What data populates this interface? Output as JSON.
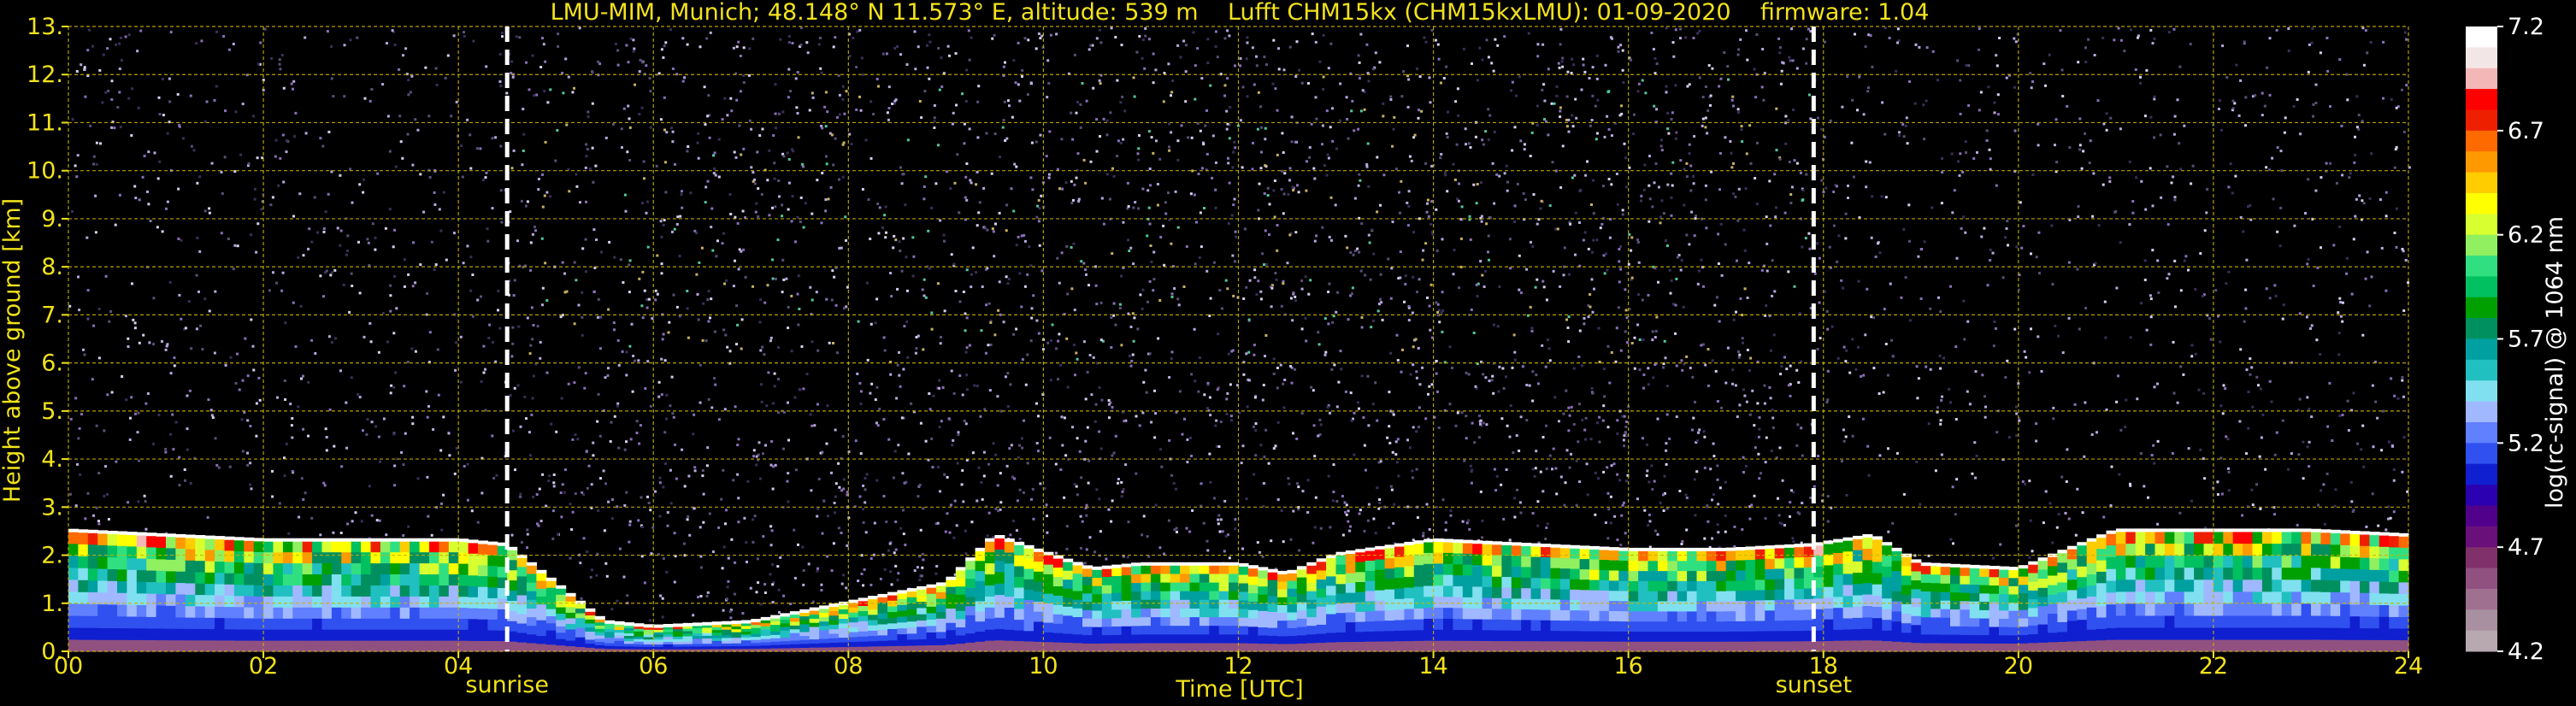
{
  "colors": {
    "background": "#000000",
    "text": "#f2e21a",
    "grid": "#c8b400",
    "event_line": "#ffffff",
    "noise": [
      "#8a6fb8",
      "#b8a8e0",
      "#5a4f7a",
      "#d8d0f0",
      "#3a2f5a"
    ]
  },
  "chart_data": {
    "type": "heatmap",
    "title": "LMU-MIM, Munich; 48.148° N 11.573° E, altitude: 539 m    Lufft CHM15kx (CHM15kxLMU): 01-09-2020    firmware: 1.04",
    "xlabel": "Time [UTC]",
    "ylabel": "Height above ground [km]",
    "xlim": [
      0,
      24
    ],
    "ylim": [
      0,
      13
    ],
    "x_ticks": [
      "00",
      "02",
      "04",
      "06",
      "08",
      "10",
      "12",
      "14",
      "16",
      "18",
      "20",
      "22",
      "24"
    ],
    "x_tick_values": [
      0,
      2,
      4,
      6,
      8,
      10,
      12,
      14,
      16,
      18,
      20,
      22,
      24
    ],
    "y_ticks": [
      "0.",
      "1.",
      "2.",
      "3.",
      "4.",
      "5.",
      "6.",
      "7.",
      "8.",
      "9.",
      "10.",
      "11.",
      "12.",
      "13."
    ],
    "y_tick_values": [
      0,
      1,
      2,
      3,
      4,
      5,
      6,
      7,
      8,
      9,
      10,
      11,
      12,
      13
    ],
    "grid": true,
    "events": [
      {
        "label": "sunrise",
        "time": 4.5
      },
      {
        "label": "sunset",
        "time": 17.9
      }
    ],
    "boundary_layer_top_km": [
      [
        0,
        2.5
      ],
      [
        1,
        2.4
      ],
      [
        2,
        2.3
      ],
      [
        3,
        2.3
      ],
      [
        4,
        2.3
      ],
      [
        4.5,
        2.2
      ],
      [
        5.5,
        0.6
      ],
      [
        6,
        0.5
      ],
      [
        7,
        0.6
      ],
      [
        8,
        1.0
      ],
      [
        9,
        1.4
      ],
      [
        9.5,
        2.4
      ],
      [
        10.5,
        1.7
      ],
      [
        11,
        1.8
      ],
      [
        12,
        1.8
      ],
      [
        12.5,
        1.6
      ],
      [
        13,
        2.0
      ],
      [
        14,
        2.3
      ],
      [
        15,
        2.2
      ],
      [
        16,
        2.1
      ],
      [
        17,
        2.1
      ],
      [
        17.9,
        2.2
      ],
      [
        18.5,
        2.4
      ],
      [
        19,
        1.8
      ],
      [
        20,
        1.7
      ],
      [
        21,
        2.5
      ],
      [
        22,
        2.5
      ],
      [
        23,
        2.5
      ],
      [
        24,
        2.4
      ]
    ],
    "colorbar": {
      "label": "log(rc-signal) @ 1064 nm",
      "min": 4.2,
      "max": 7.2,
      "tick_labels": [
        "7.2",
        "6.7",
        "6.2",
        "5.7",
        "5.2",
        "4.7",
        "4.2"
      ],
      "tick_values": [
        7.2,
        6.7,
        6.2,
        5.7,
        5.2,
        4.7,
        4.2
      ],
      "colors_top_to_bottom": [
        "#ffffff",
        "#f3e6e6",
        "#f4b7b7",
        "#ff0000",
        "#ee1f00",
        "#ff6a00",
        "#ff9900",
        "#ffcc00",
        "#ffff00",
        "#d8ff30",
        "#90f060",
        "#30e080",
        "#00c060",
        "#00a000",
        "#009060",
        "#00a0a0",
        "#20c0c0",
        "#80e0f0",
        "#a0b8ff",
        "#6080ff",
        "#3050f0",
        "#1020d0",
        "#2a00b0",
        "#50008a",
        "#6a107a",
        "#80306a",
        "#905080",
        "#a07090",
        "#a890a0",
        "#b8a8b0"
      ]
    }
  }
}
